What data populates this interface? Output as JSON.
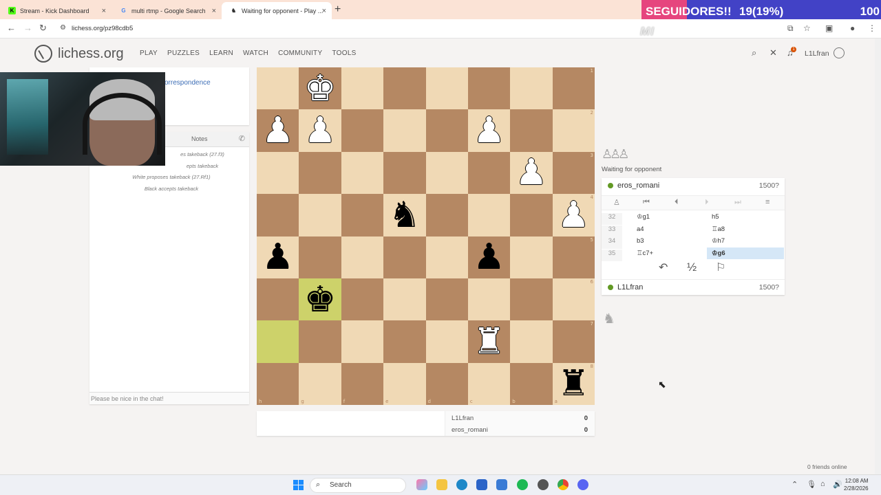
{
  "browser": {
    "tabs": [
      {
        "title": "Stream - Kick Dashboard",
        "favicon": "K"
      },
      {
        "title": "multi rtmp - Google Search",
        "favicon": "G"
      },
      {
        "title": "Waiting for opponent - Play ...",
        "favicon": "♞"
      }
    ],
    "url": "lichess.org/pz98cdb5"
  },
  "overlay": {
    "label": "SEGUIDORES!!",
    "progress": "19(19%)",
    "goal": "100",
    "watermark": "MI"
  },
  "site": {
    "logo": "lichess.org",
    "nav": [
      "PLAY",
      "PUZZLES",
      "LEARN",
      "WATCH",
      "COMMUNITY",
      "TOOLS"
    ],
    "notifications": "1",
    "username": "L1Lfran"
  },
  "game_info": {
    "correspondence": "orrespondence"
  },
  "chat": {
    "notes_tab": "Notes",
    "messages": [
      "es takeback (27.f3)",
      "epts takeback",
      "White proposes takeback (27.Rf1)",
      "Black accepts takeback"
    ],
    "input_placeholder": "Please be nice in the chat!"
  },
  "board": {
    "orientation": "black",
    "rank_labels": [
      "1",
      "2",
      "3",
      "4",
      "5",
      "6",
      "7",
      "8"
    ],
    "file_labels": [
      "h",
      "g",
      "f",
      "e",
      "d",
      "c",
      "b",
      "a"
    ],
    "highlight": [
      "g6",
      "h7"
    ],
    "squares": [
      [
        "",
        "♔",
        "",
        "",
        "",
        "",
        "",
        ""
      ],
      [
        "♙",
        "♙",
        "",
        "",
        "",
        "♙",
        "",
        ""
      ],
      [
        "",
        "",
        "",
        "",
        "",
        "",
        "♙",
        ""
      ],
      [
        "",
        "",
        "",
        "♞",
        "",
        "",
        "",
        "♙"
      ],
      [
        "♟",
        "",
        "",
        "",
        "",
        "♟",
        "",
        ""
      ],
      [
        "",
        "♚",
        "",
        "",
        "",
        "",
        "",
        ""
      ],
      [
        "",
        "",
        "",
        "",
        "",
        "♖",
        "",
        ""
      ],
      [
        "",
        "",
        "",
        "",
        "",
        "",
        "",
        "♜"
      ]
    ]
  },
  "scores": [
    {
      "name": "L1Lfran",
      "score": "0"
    },
    {
      "name": "eros_romani",
      "score": "0"
    }
  ],
  "right_panel": {
    "captured": "♙♙♙",
    "status": "Waiting for opponent",
    "opponent": {
      "name": "eros_romani",
      "rating": "1500?"
    },
    "me": {
      "name": "L1Lfran",
      "rating": "1500?"
    },
    "moves": [
      {
        "num": "32",
        "white": "♔g1",
        "black": "h5"
      },
      {
        "num": "33",
        "white": "a4",
        "black": "♖a8"
      },
      {
        "num": "34",
        "white": "b3",
        "black": "♔h7"
      },
      {
        "num": "35",
        "white": "♖c7+",
        "black": "♔g6"
      }
    ],
    "draw_symbol": "½",
    "captured_bottom": "♞"
  },
  "friends": "0 friends online",
  "taskbar": {
    "search": "Search",
    "time": "12:08 AM",
    "date": "2/28/2026"
  }
}
